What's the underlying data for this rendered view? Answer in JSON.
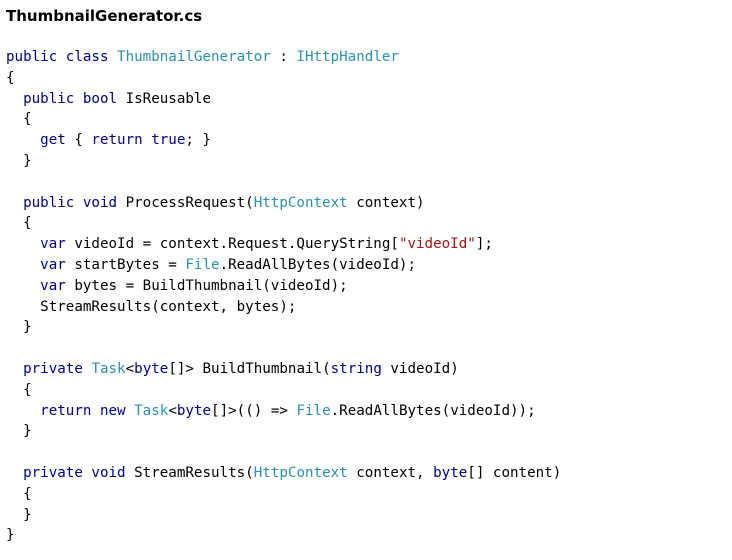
{
  "file_title": "ThumbnailGenerator.cs",
  "colors": {
    "keyword": "#00008b",
    "type": "#2b91af",
    "string": "#a31515",
    "plain": "#000000"
  },
  "code_lines": [
    {
      "indent": "",
      "tokens": [
        [
          "kw",
          "public class "
        ],
        [
          "ty",
          "ThumbnailGenerator"
        ],
        [
          "pl",
          " : "
        ],
        [
          "ty",
          "IHttpHandler"
        ]
      ]
    },
    {
      "indent": "",
      "tokens": [
        [
          "pl",
          "{"
        ]
      ]
    },
    {
      "indent": "  ",
      "tokens": [
        [
          "kw",
          "public bool "
        ],
        [
          "pl",
          "IsReusable"
        ]
      ]
    },
    {
      "indent": "  ",
      "tokens": [
        [
          "pl",
          "{"
        ]
      ]
    },
    {
      "indent": "    ",
      "tokens": [
        [
          "kw",
          "get"
        ],
        [
          "pl",
          " { "
        ],
        [
          "kw",
          "return true"
        ],
        [
          "pl",
          "; }"
        ]
      ]
    },
    {
      "indent": "  ",
      "tokens": [
        [
          "pl",
          "}"
        ]
      ]
    },
    {
      "indent": "",
      "tokens": []
    },
    {
      "indent": "  ",
      "tokens": [
        [
          "kw",
          "public void "
        ],
        [
          "pl",
          "ProcessRequest("
        ],
        [
          "ty",
          "HttpContext"
        ],
        [
          "pl",
          " context)"
        ]
      ]
    },
    {
      "indent": "  ",
      "tokens": [
        [
          "pl",
          "{"
        ]
      ]
    },
    {
      "indent": "    ",
      "tokens": [
        [
          "kw",
          "var "
        ],
        [
          "pl",
          "videoId = context.Request.QueryString["
        ],
        [
          "str",
          "\"videoId\""
        ],
        [
          "pl",
          "];"
        ]
      ]
    },
    {
      "indent": "    ",
      "tokens": [
        [
          "kw",
          "var "
        ],
        [
          "pl",
          "startBytes = "
        ],
        [
          "ty",
          "File"
        ],
        [
          "pl",
          ".ReadAllBytes(videoId);"
        ]
      ]
    },
    {
      "indent": "    ",
      "tokens": [
        [
          "kw",
          "var "
        ],
        [
          "pl",
          "bytes = BuildThumbnail(videoId);"
        ]
      ]
    },
    {
      "indent": "    ",
      "tokens": [
        [
          "pl",
          "StreamResults(context, bytes);"
        ]
      ]
    },
    {
      "indent": "  ",
      "tokens": [
        [
          "pl",
          "}"
        ]
      ]
    },
    {
      "indent": "",
      "tokens": []
    },
    {
      "indent": "  ",
      "tokens": [
        [
          "kw",
          "private "
        ],
        [
          "ty",
          "Task"
        ],
        [
          "pl",
          "<"
        ],
        [
          "kw",
          "byte"
        ],
        [
          "pl",
          "[]> BuildThumbnail("
        ],
        [
          "kw",
          "string "
        ],
        [
          "pl",
          "videoId)"
        ]
      ]
    },
    {
      "indent": "  ",
      "tokens": [
        [
          "pl",
          "{"
        ]
      ]
    },
    {
      "indent": "    ",
      "tokens": [
        [
          "kw",
          "return new "
        ],
        [
          "ty",
          "Task"
        ],
        [
          "pl",
          "<"
        ],
        [
          "kw",
          "byte"
        ],
        [
          "pl",
          "[]>(() => "
        ],
        [
          "ty",
          "File"
        ],
        [
          "pl",
          ".ReadAllBytes(videoId));"
        ]
      ]
    },
    {
      "indent": "  ",
      "tokens": [
        [
          "pl",
          "}"
        ]
      ]
    },
    {
      "indent": "",
      "tokens": []
    },
    {
      "indent": "  ",
      "tokens": [
        [
          "kw",
          "private void "
        ],
        [
          "pl",
          "StreamResults("
        ],
        [
          "ty",
          "HttpContext"
        ],
        [
          "pl",
          " context, "
        ],
        [
          "kw",
          "byte"
        ],
        [
          "pl",
          "[] content)"
        ]
      ]
    },
    {
      "indent": "  ",
      "tokens": [
        [
          "pl",
          "{"
        ]
      ]
    },
    {
      "indent": "  ",
      "tokens": [
        [
          "pl",
          "}"
        ]
      ]
    },
    {
      "indent": "",
      "tokens": [
        [
          "pl",
          "}"
        ]
      ]
    }
  ]
}
